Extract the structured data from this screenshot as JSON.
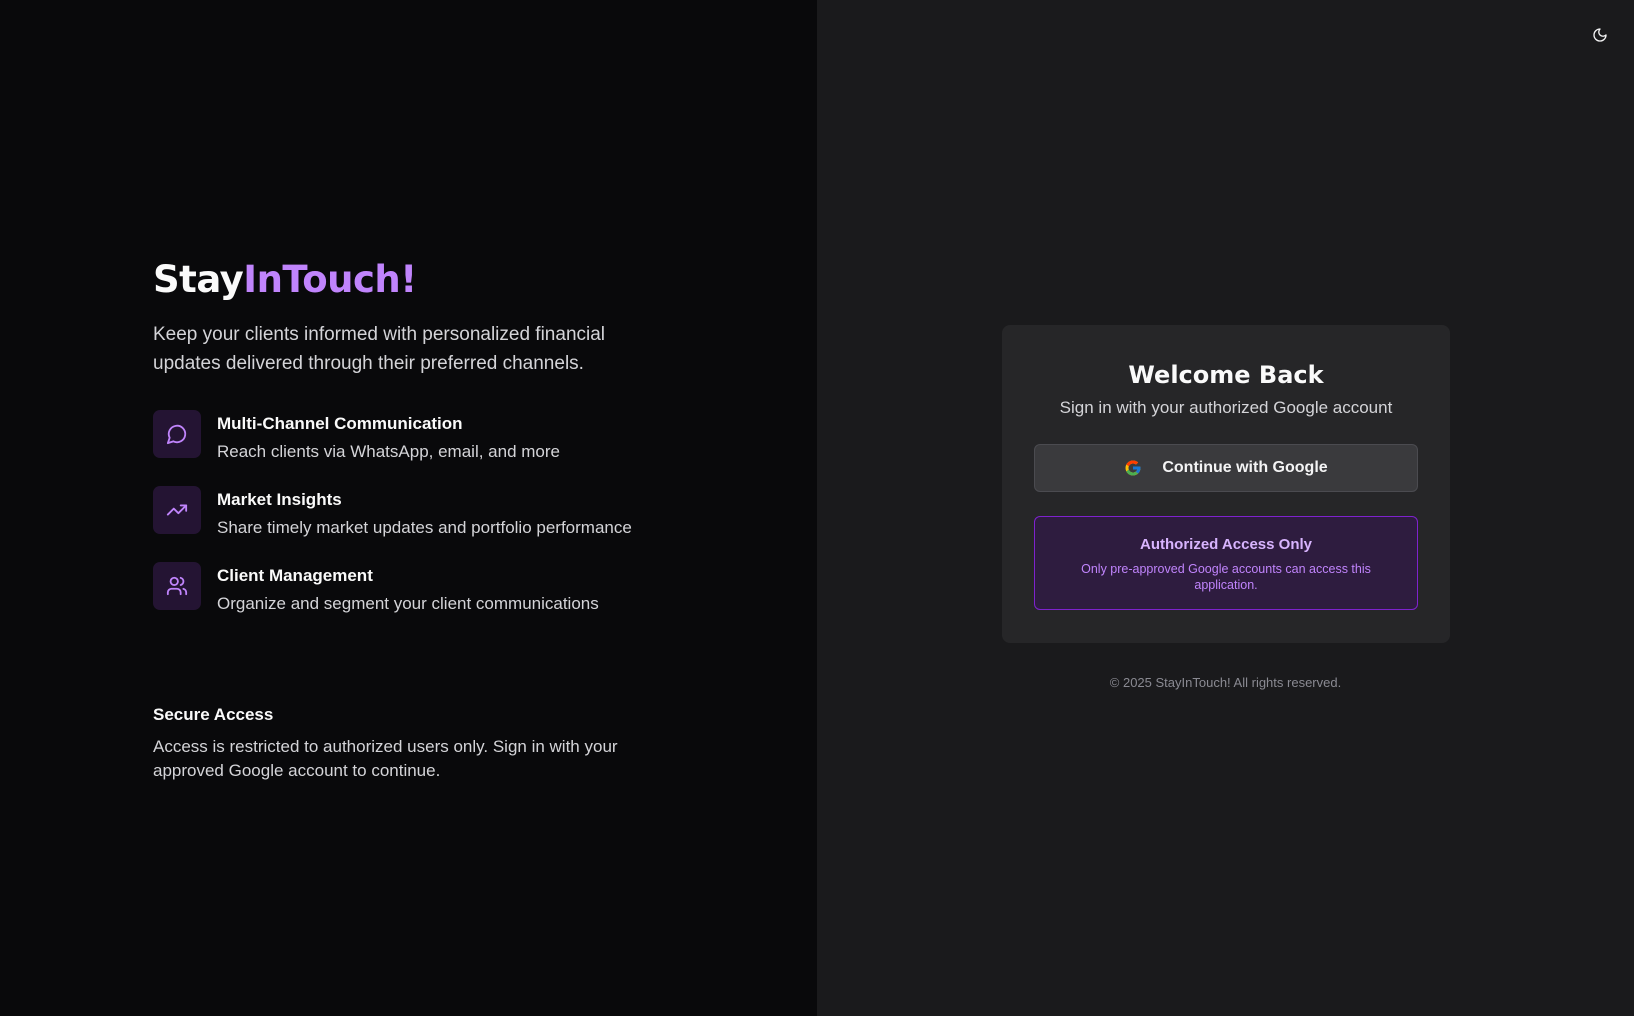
{
  "brand": {
    "name_plain": "Stay",
    "name_accent": "InTouch!"
  },
  "hero": {
    "tagline": "Keep your clients informed with personalized financial updates delivered through their preferred channels."
  },
  "features": [
    {
      "icon": "message-circle-icon",
      "title": "Multi-Channel Communication",
      "description": "Reach clients via WhatsApp, email, and more"
    },
    {
      "icon": "trending-up-icon",
      "title": "Market Insights",
      "description": "Share timely market updates and portfolio performance"
    },
    {
      "icon": "users-icon",
      "title": "Client Management",
      "description": "Organize and segment your client communications"
    }
  ],
  "secure": {
    "title": "Secure Access",
    "description": "Access is restricted to authorized users only. Sign in with your approved Google account to continue."
  },
  "theme_toggle": {
    "icon": "moon-icon"
  },
  "login_card": {
    "title": "Welcome Back",
    "subtitle": "Sign in with your authorized Google account",
    "google_button": {
      "icon": "google-icon",
      "label": "Continue with Google"
    },
    "notice": {
      "title": "Authorized Access Only",
      "description": "Only pre-approved Google accounts can access this application."
    }
  },
  "footer": {
    "copyright": "© 2025 StayInTouch! All rights reserved."
  },
  "colors": {
    "left_bg": "#09090b",
    "right_bg": "#1a1a1c",
    "accent": "#c084fc",
    "card_bg": "#262628",
    "notice_border": "#7e22ce"
  }
}
